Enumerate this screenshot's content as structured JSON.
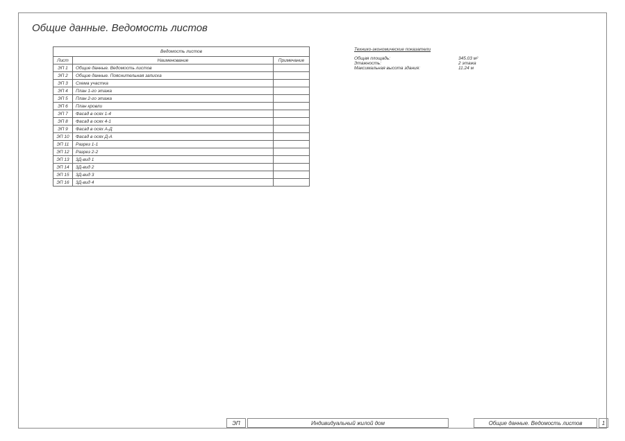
{
  "page_title": "Общие данные. Ведомость листов",
  "table": {
    "caption": "Ведомость листов",
    "columns": [
      "Лист",
      "Наименование",
      "Примечание"
    ],
    "rows": [
      {
        "num": "ЭП 1",
        "name": "Общие данные. Ведомость листов",
        "note": ""
      },
      {
        "num": "ЭП 2",
        "name": "Общие данные. Пояснительная записка",
        "note": ""
      },
      {
        "num": "ЭП 3",
        "name": "Схема участка",
        "note": ""
      },
      {
        "num": "ЭП 4",
        "name": "План 1-го этажа",
        "note": ""
      },
      {
        "num": "ЭП 5",
        "name": "План 2-го этажа",
        "note": ""
      },
      {
        "num": "ЭП 6",
        "name": "План кровли",
        "note": ""
      },
      {
        "num": "ЭП 7",
        "name": "Фасад в осях 1-4",
        "note": ""
      },
      {
        "num": "ЭП 8",
        "name": "Фасад в осях 4-1",
        "note": ""
      },
      {
        "num": "ЭП 9",
        "name": "Фасад в осях А-Д",
        "note": ""
      },
      {
        "num": "ЭП 10",
        "name": "Фасад в осях Д-А",
        "note": ""
      },
      {
        "num": "ЭП 11",
        "name": "Разрез 1-1",
        "note": ""
      },
      {
        "num": "ЭП 12",
        "name": "Разрез 2-2",
        "note": ""
      },
      {
        "num": "ЭП 13",
        "name": "3Д-вид 1",
        "note": ""
      },
      {
        "num": "ЭП 14",
        "name": "3Д-вид 2",
        "note": ""
      },
      {
        "num": "ЭП 15",
        "name": "3Д-вид 3",
        "note": ""
      },
      {
        "num": "ЭП 16",
        "name": "3Д-вид 4",
        "note": ""
      }
    ]
  },
  "tech": {
    "title": "Технико-экономические показатели",
    "items": [
      {
        "label": "Общая площадь:",
        "value": "345.03 м²"
      },
      {
        "label": "Этажность:",
        "value": "2 этажа"
      },
      {
        "label": "Максимальная высота здания:",
        "value": "11.24 м"
      }
    ]
  },
  "footer": {
    "code": "ЭП",
    "project": "Индивидуальный жилой дом",
    "sheet_name": "Общие данные. Ведомость листов",
    "page": "1"
  }
}
